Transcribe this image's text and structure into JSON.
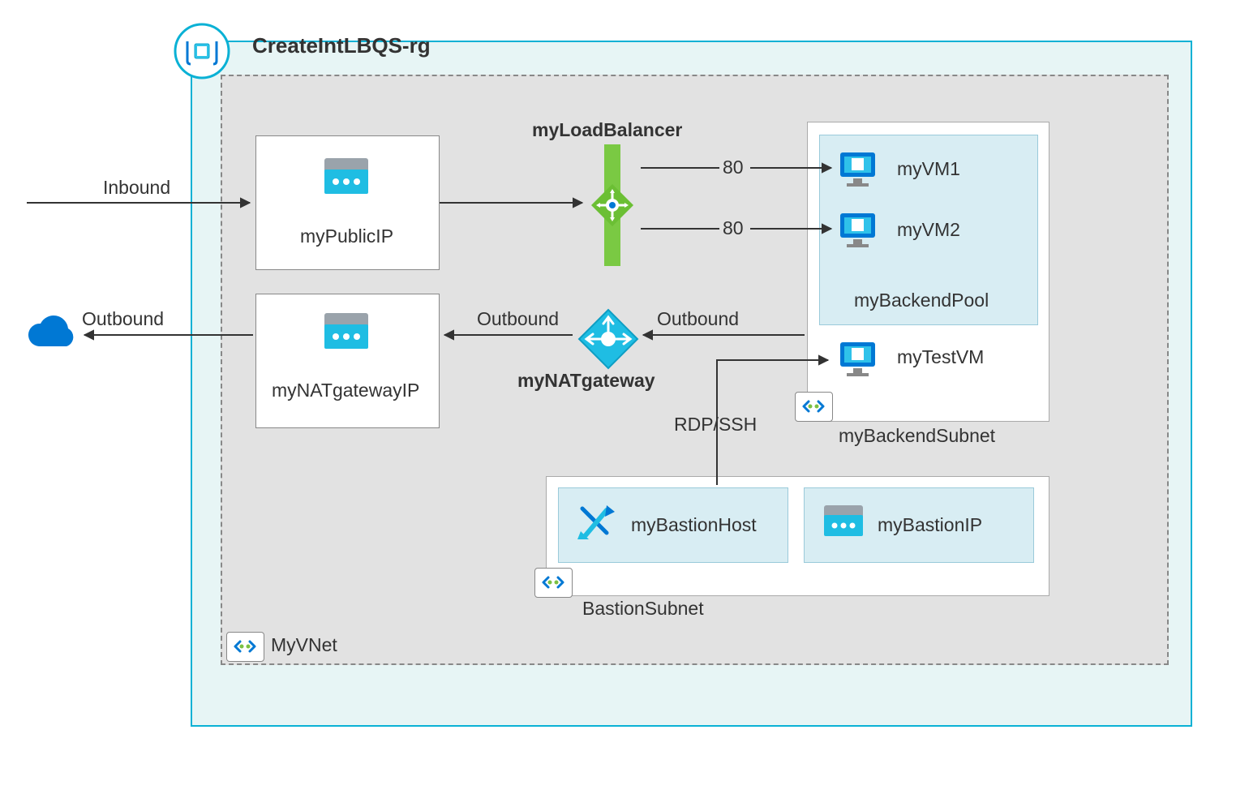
{
  "rg": {
    "title": "CreateIntLBQS-rg"
  },
  "vnet": {
    "label": "MyVNet"
  },
  "io": {
    "inbound": "Inbound",
    "outbound": "Outbound",
    "outbound2": "Outbound",
    "outbound3": "Outbound"
  },
  "publicip": {
    "label": "myPublicIP"
  },
  "natip": {
    "label": "myNATgatewayIP"
  },
  "lb": {
    "label": "myLoadBalancer"
  },
  "natgw": {
    "label": "myNATgateway"
  },
  "ports": {
    "p1": "80",
    "p2": "80"
  },
  "rdpssh": "RDP/SSH",
  "backend": {
    "subnet": "myBackendSubnet",
    "pool": "myBackendPool",
    "vm1": "myVM1",
    "vm2": "myVM2",
    "testvm": "myTestVM"
  },
  "bastion": {
    "subnet": "BastionSubnet",
    "host": "myBastionHost",
    "ip": "myBastionIP"
  }
}
